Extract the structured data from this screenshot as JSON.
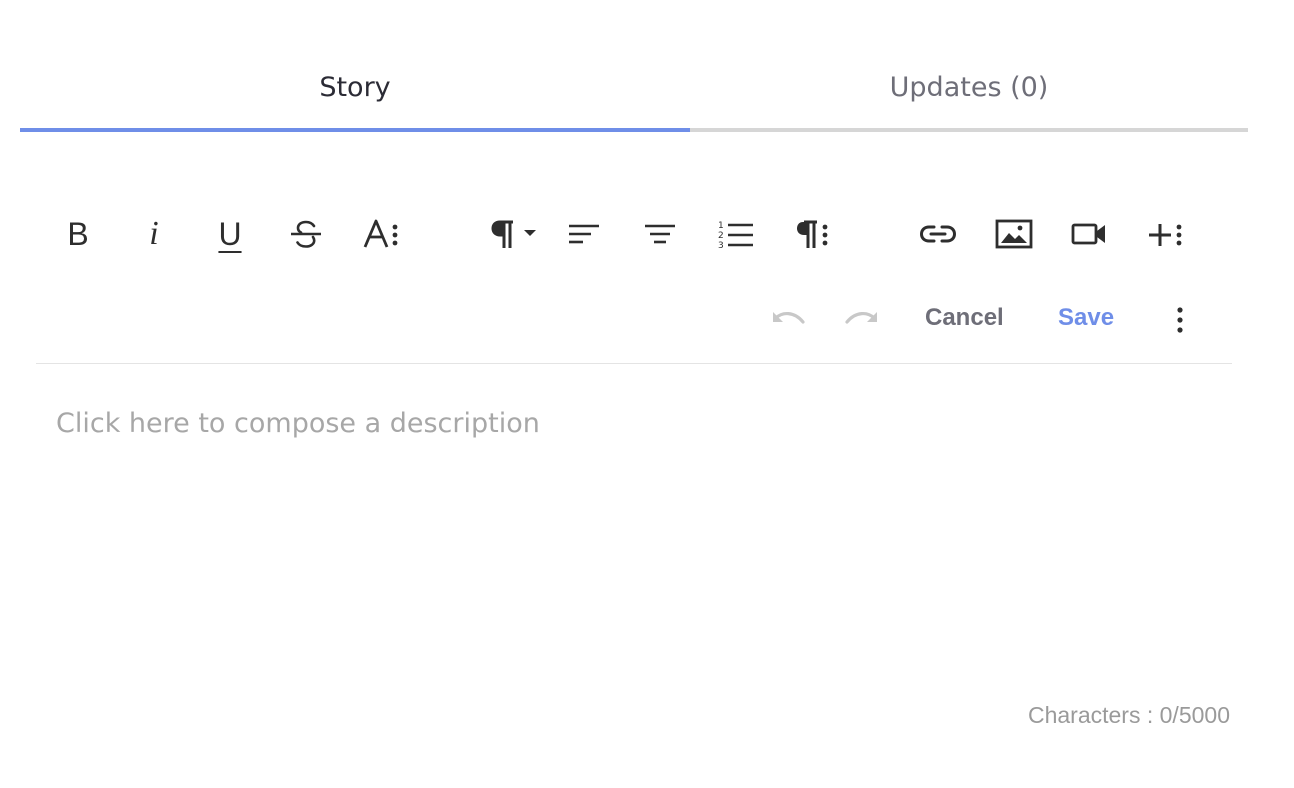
{
  "tabs": [
    {
      "label": "Story",
      "active": true
    },
    {
      "label": "Updates (0)",
      "active": false
    }
  ],
  "toolbar": {
    "bold_label": "B",
    "italic_label": "i",
    "underline_label": "U",
    "buttons": [
      "bold-icon",
      "italic-icon",
      "underline-icon",
      "strikethrough-icon",
      "font-options-icon",
      "paragraph-format-icon",
      "align-left-icon",
      "align-center-icon",
      "ordered-list-icon",
      "paragraph-options-icon",
      "link-icon",
      "image-icon",
      "video-icon",
      "insert-more-icon"
    ]
  },
  "actions": {
    "undo_icon": "undo-icon",
    "redo_icon": "redo-icon",
    "cancel_label": "Cancel",
    "save_label": "Save",
    "more_icon": "more-vertical-icon"
  },
  "editor": {
    "placeholder": "Click here to compose a description"
  },
  "footer": {
    "char_count": "Characters : 0/5000"
  },
  "colors": {
    "accent": "#6f8ee8",
    "text": "#2b2b35",
    "muted": "#6e6e78",
    "placeholder": "#a7a7a7",
    "disabled": "#c8c8c8"
  }
}
